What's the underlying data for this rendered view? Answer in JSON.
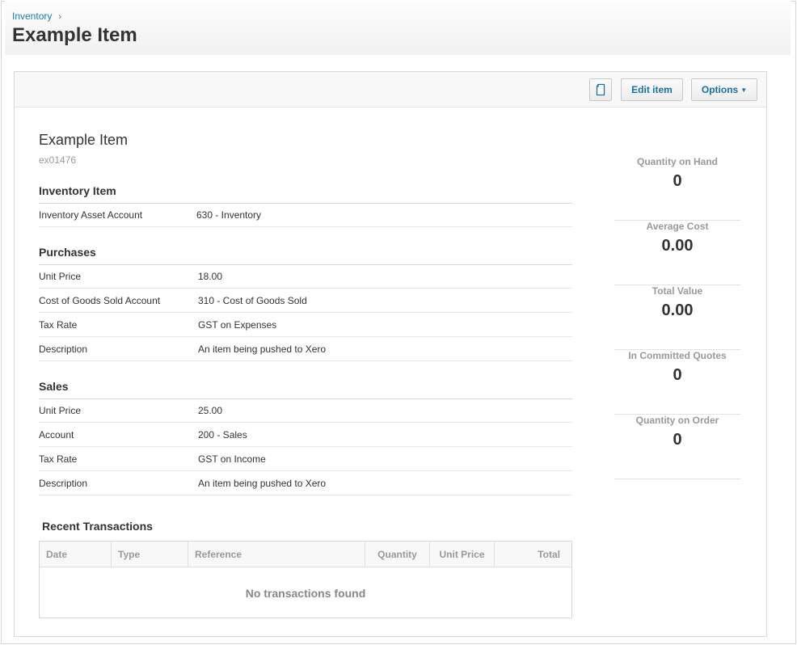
{
  "breadcrumb": {
    "parent": "Inventory",
    "separator": "›"
  },
  "page_title": "Example Item",
  "toolbar": {
    "edit_label": "Edit item",
    "options_label": "Options",
    "options_caret": "▼"
  },
  "item": {
    "name": "Example Item",
    "code": "ex01476"
  },
  "inventory_item": {
    "title": "Inventory Item",
    "rows": [
      {
        "label": "Inventory Asset Account",
        "value": "630 - Inventory"
      }
    ]
  },
  "purchases": {
    "title": "Purchases",
    "rows": [
      {
        "label": "Unit Price",
        "value": "18.00"
      },
      {
        "label": "Cost of Goods Sold Account",
        "value": "310 - Cost of Goods Sold"
      },
      {
        "label": "Tax Rate",
        "value": "GST on Expenses"
      },
      {
        "label": "Description",
        "value": "An item being pushed to Xero"
      }
    ]
  },
  "sales": {
    "title": "Sales",
    "rows": [
      {
        "label": "Unit Price",
        "value": "25.00"
      },
      {
        "label": "Account",
        "value": "200 - Sales"
      },
      {
        "label": "Tax Rate",
        "value": "GST on Income"
      },
      {
        "label": "Description",
        "value": "An item being pushed to Xero"
      }
    ]
  },
  "recent_transactions": {
    "title": "Recent Transactions",
    "columns": [
      "Date",
      "Type",
      "Reference",
      "Quantity",
      "Unit Price",
      "Total"
    ],
    "empty_message": "No transactions found"
  },
  "stats": [
    {
      "label": "Quantity on Hand",
      "value": "0"
    },
    {
      "label": "Average Cost",
      "value": "0.00"
    },
    {
      "label": "Total Value",
      "value": "0.00"
    },
    {
      "label": "In Committed Quotes",
      "value": "0"
    },
    {
      "label": "Quantity on Order",
      "value": "0"
    }
  ],
  "icons": {
    "document": "document-icon"
  },
  "colors": {
    "link": "#1a7bb5",
    "button_text": "#1a6fa5",
    "muted": "#999999"
  }
}
